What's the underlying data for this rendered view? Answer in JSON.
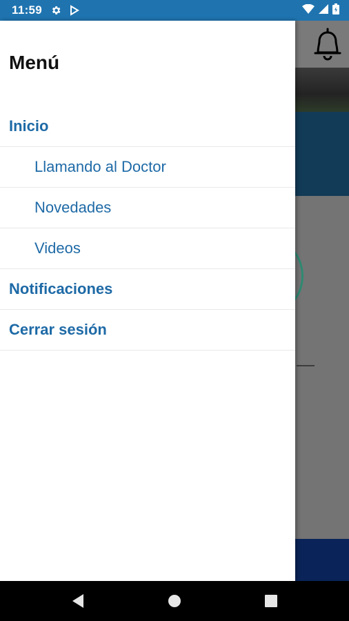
{
  "status_bar": {
    "time": "11:59",
    "icons": [
      "gear-icon",
      "play-store-icon",
      "wifi-icon",
      "signal-icon",
      "battery-icon"
    ],
    "background_color": "#1f74b0"
  },
  "background_app": {
    "header_icon": "bell-icon",
    "footer_color": "#0a2459",
    "banner_color": "#123b57"
  },
  "drawer": {
    "title": "Menú",
    "items": [
      {
        "label": "Inicio",
        "level": "top"
      },
      {
        "label": "Llamando al Doctor",
        "level": "sub"
      },
      {
        "label": "Novedades",
        "level": "sub"
      },
      {
        "label": "Videos",
        "level": "sub"
      },
      {
        "label": "Notificaciones",
        "level": "top"
      },
      {
        "label": "Cerrar sesión",
        "level": "top"
      }
    ],
    "link_color": "#1e6aa6"
  },
  "nav_bar": {
    "buttons": [
      "back-icon",
      "home-icon",
      "recents-icon"
    ]
  }
}
